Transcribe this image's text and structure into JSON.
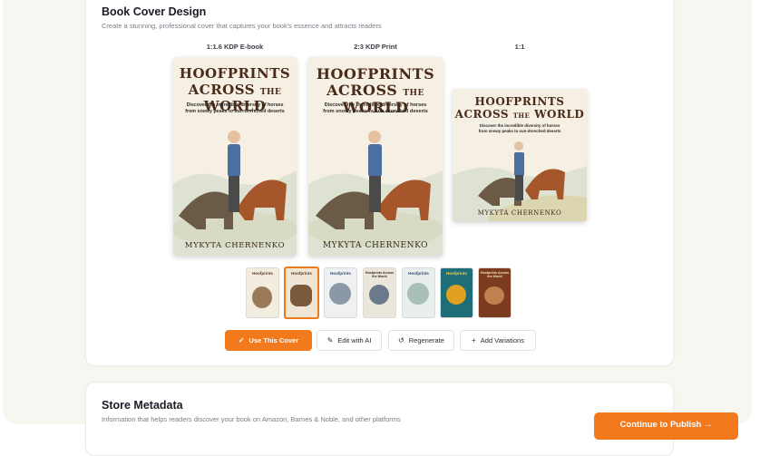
{
  "cover_section": {
    "title": "Book Cover Design",
    "subtitle": "Create a stunning, professional cover that captures your book's essence and attracts readers",
    "formats": [
      {
        "label": "1:1.6 KDP E-book"
      },
      {
        "label": "2:3 KDP Print"
      },
      {
        "label": "1:1"
      }
    ],
    "cover": {
      "title_line1": "HOOFPRINTS",
      "title_line2a": "ACROSS",
      "title_line2b": "THE",
      "title_line2c": "WORLD",
      "tagline_line1": "Discover the incredible diversity of horses",
      "tagline_line2": "from snowy peaks to sun-drenched deserts",
      "author": "MYKYTA CHERNENKO"
    },
    "thumbnails": [
      {
        "label": "Hoofprints",
        "selected": false,
        "color": "#f3ece0"
      },
      {
        "label": "Hoofprints",
        "selected": true,
        "color": "#efe6d6"
      },
      {
        "label": "Hoofprints",
        "selected": false,
        "color": "#eef0f2"
      },
      {
        "label": "Hoofprints Across the World",
        "selected": false,
        "color": "#ebe6dc"
      },
      {
        "label": "Hoofprints",
        "selected": false,
        "color": "#e9efee"
      },
      {
        "label": "Hoofprints",
        "selected": false,
        "color": "#1d6e78"
      },
      {
        "label": "Hoofprints Across the World",
        "selected": false,
        "color": "#7b3b1f"
      }
    ],
    "actions": {
      "use_cover": "Use This Cover",
      "edit_ai": "Edit with AI",
      "regenerate": "Regenerate",
      "add_variations": "Add Variations"
    }
  },
  "metadata_section": {
    "title": "Store Metadata",
    "subtitle": "Information that helps readers discover your book on Amazon, Barnes & Noble, and other platforms"
  },
  "footer": {
    "continue": "Continue to Publish →"
  },
  "colors": {
    "accent": "#f27a1c",
    "background": "#f7f6f1"
  }
}
